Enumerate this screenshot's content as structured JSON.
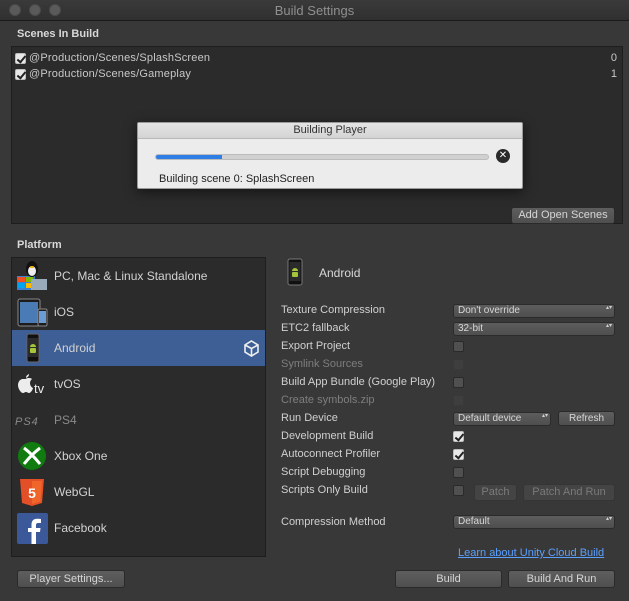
{
  "window": {
    "title": "Build Settings"
  },
  "scenes": {
    "header": "Scenes In Build",
    "items": [
      {
        "checked": true,
        "path": "@Production/Scenes/SplashScreen",
        "index": "0"
      },
      {
        "checked": true,
        "path": "@Production/Scenes/Gameplay",
        "index": "1"
      }
    ],
    "add_open_scenes": "Add Open Scenes"
  },
  "progress_dialog": {
    "title": "Building Player",
    "progress": 0.2,
    "status": "Building scene 0: SplashScreen",
    "accent": "#2f7ee6"
  },
  "platform": {
    "header": "Platform",
    "items": [
      {
        "label": "PC, Mac & Linux Standalone",
        "icon": "tux-windows-mac-icon",
        "selected": false
      },
      {
        "label": "iOS",
        "icon": "ipad-iphone-icon",
        "selected": false
      },
      {
        "label": "Android",
        "icon": "android-phone-icon",
        "selected": true
      },
      {
        "label": "tvOS",
        "icon": "apple-tv-icon",
        "selected": false
      },
      {
        "label": "PS4",
        "icon": "ps4-logo-icon",
        "selected": false
      },
      {
        "label": "Xbox One",
        "icon": "xbox-logo-icon",
        "selected": false
      },
      {
        "label": "WebGL",
        "icon": "html5-icon",
        "selected": false
      },
      {
        "label": "Facebook",
        "icon": "facebook-icon",
        "selected": false
      }
    ],
    "selected_color": "#3e5f96"
  },
  "details": {
    "title": "Android",
    "texture_compression": {
      "label": "Texture Compression",
      "value": "Don't override"
    },
    "etc2_fallback": {
      "label": "ETC2 fallback",
      "value": "32-bit"
    },
    "export_project": {
      "label": "Export Project",
      "checked": false
    },
    "symlink_sources": {
      "label": "Symlink Sources",
      "checked": false,
      "disabled": true
    },
    "build_app_bundle": {
      "label": "Build App Bundle (Google Play)",
      "checked": false
    },
    "create_symbols": {
      "label": "Create symbols.zip",
      "checked": false,
      "disabled": true
    },
    "run_device": {
      "label": "Run Device",
      "value": "Default device",
      "refresh": "Refresh"
    },
    "development_build": {
      "label": "Development Build",
      "checked": true
    },
    "autoconnect_profiler": {
      "label": "Autoconnect Profiler",
      "checked": true
    },
    "script_debugging": {
      "label": "Script Debugging",
      "checked": false
    },
    "scripts_only_build": {
      "label": "Scripts Only Build",
      "checked": false,
      "patch": "Patch",
      "patch_and_run": "Patch And Run"
    },
    "compression_method": {
      "label": "Compression Method",
      "value": "Default"
    },
    "cloud_build_link": "Learn about Unity Cloud Build"
  },
  "footer": {
    "player_settings": "Player Settings...",
    "build": "Build",
    "build_and_run": "Build And Run"
  }
}
